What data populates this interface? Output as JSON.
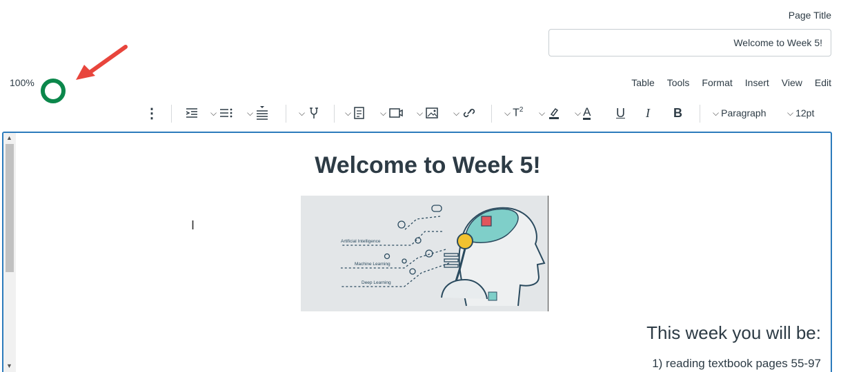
{
  "page_title": {
    "label": "Page Title",
    "value": "Welcome to Week 5!"
  },
  "accessibility": {
    "score": "100%",
    "ring_color": "#0b874b"
  },
  "menubar": {
    "edit": "Edit",
    "view": "View",
    "insert": "Insert",
    "format": "Format",
    "tools": "Tools",
    "table": "Table"
  },
  "toolbar": {
    "font_size": "12pt",
    "block_format": "Paragraph"
  },
  "content": {
    "heading": "Welcome to Week 5!",
    "image_alt": "Artificial Intelligence, Machine Learning, Deep Learning illustration",
    "image_labels": [
      "Artificial Intelligence",
      "Machine Learning",
      "Deep Learning"
    ],
    "subheading": "This week you will be:",
    "item1": "1) reading textbook pages 55-97"
  },
  "colors": {
    "accent": "#2b7abc",
    "arrow": "#e8453c",
    "text": "#2d3b45"
  }
}
